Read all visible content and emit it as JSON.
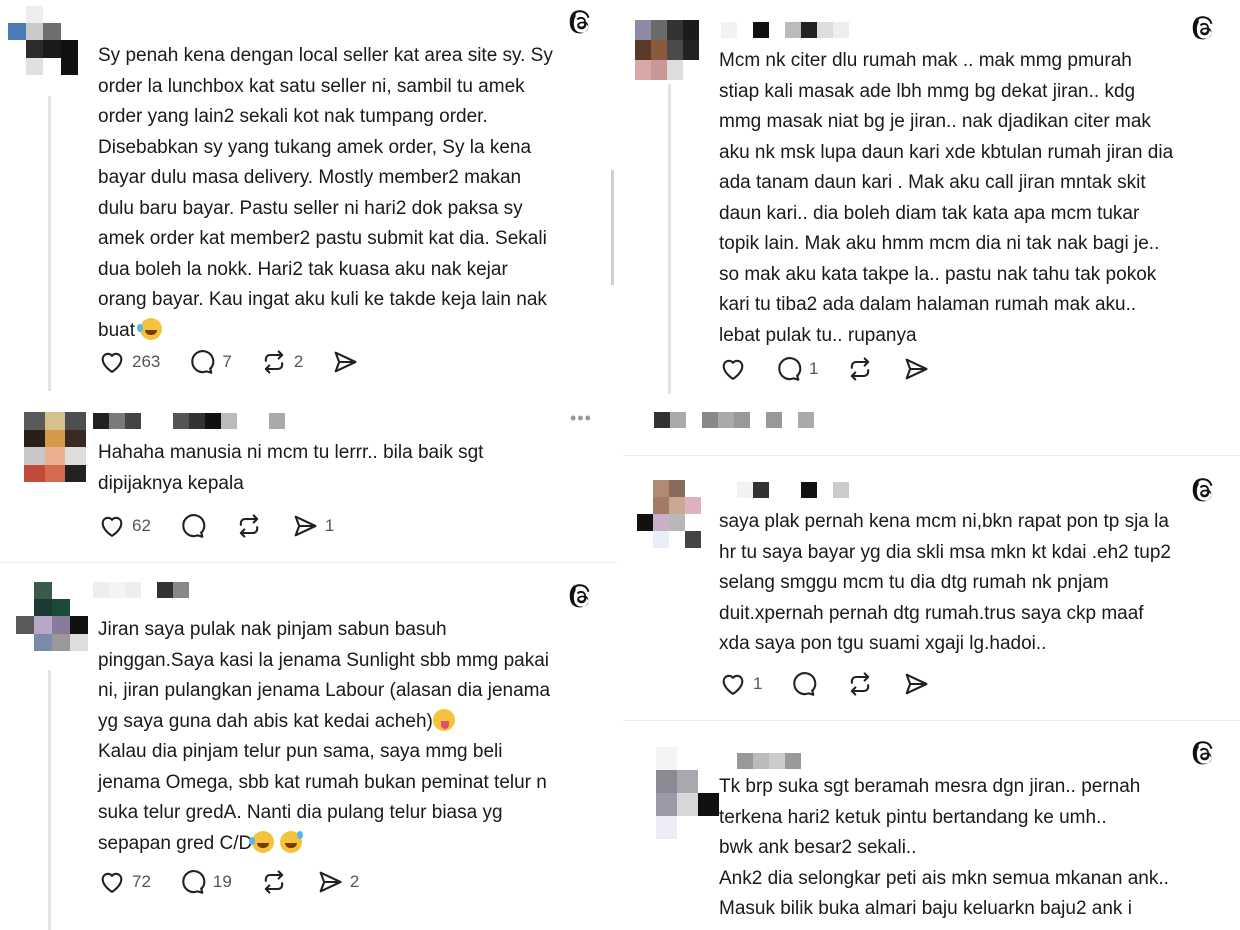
{
  "colors": {
    "text": "#1a1a1a",
    "muted": "#555555",
    "divider": "#ececec",
    "icon": "#222222"
  },
  "icons": {
    "threads": "threads-logo-icon",
    "like": "heart-icon",
    "reply": "comment-icon",
    "repost": "repost-icon",
    "share": "send-icon",
    "more": "more-icon"
  },
  "posts": [
    {
      "text": "Sy penah kena dengan local seller kat area site sy. Sy\norder la lunchbox kat satu seller ni, sambil tu amek\norder yang lain2 sekali kot nak tumpang order.\nDisebabkan sy yang tukang amek order, Sy la kena\nbayar dulu masa delivery. Mostly member2 makan\ndulu baru bayar. Pastu seller ni hari2 dok paksa sy\namek order kat member2 pastu submit kat dia. Sekali\ndua boleh la nokk. Hari2 tak kuasa aku nak kejar\norang bayar. Kau ingat aku kuli ke takde keja lain nak\nbuat ",
      "likes": "263",
      "replies": "7",
      "reposts": "2",
      "shares": ""
    },
    {
      "text": "Hahaha manusia ni mcm tu lerrr.. bila baik sgt\ndipijaknya kepala",
      "likes": "62",
      "replies": "",
      "reposts": "",
      "shares": "1"
    },
    {
      "text_a": "Jiran saya pulak nak pinjam sabun basuh\npinggan.Saya kasi la jenama Sunlight sbb mmg pakai\nni, jiran pulangkan jenama Labour (alasan dia jenama\nyg saya guna dah abis kat kedai acheh)",
      "text_b": "Kalau dia pinjam telur pun sama, saya mmg beli\njenama Omega, sbb kat rumah bukan peminat telur n\nsuka telur gredA. Nanti dia pulang telur biasa yg\nsepapan gred C/D",
      "likes": "72",
      "replies": "19",
      "reposts": "",
      "shares": "2"
    },
    {
      "text": "Mcm nk citer dlu rumah mak .. mak mmg pmurah\nstiap kali masak ade lbh mmg bg dekat jiran.. kdg\nmmg masak niat bg je jiran.. nak djadikan citer mak\naku nk msk lupa daun kari xde kbtulan rumah jiran dia\nada tanam daun kari . Mak aku call jiran mntak skit\ndaun kari.. dia boleh diam tak kata apa mcm tukar\ntopik lain. Mak aku hmm mcm dia ni tak nak bagi je..\nso mak aku kata takpe la.. pastu nak tahu tak pokok\nkari tu tiba2 ada dalam halaman rumah mak aku..\nlebat pulak tu.. rupanya",
      "likes": "",
      "replies": "1",
      "reposts": "",
      "shares": ""
    },
    {
      "text": "saya plak pernah kena mcm ni,bkn rapat pon tp sja la\nhr tu saya bayar yg dia skli msa mkn kt kdai .eh2 tup2\nselang smggu mcm tu dia dtg rumah nk pnjam\nduit.xpernah pernah dtg rumah.trus saya ckp maaf\nxda saya pon tgu suami xgaji lg.hadoi..",
      "likes": "1",
      "replies": "",
      "reposts": "",
      "shares": ""
    },
    {
      "text_a": "Tk brp suka sgt beramah mesra dgn jiran.. pernah\nterkena hari2 ketuk pintu bertandang ke umh..",
      "text_b": "bwk ank besar2 sekali..",
      "text_c": "Ank2 dia selongkar peti ais mkn semua mkanan ank..",
      "text_d": "Masuk bilik buka almari baju keluarkn baju2 ank i"
    }
  ]
}
